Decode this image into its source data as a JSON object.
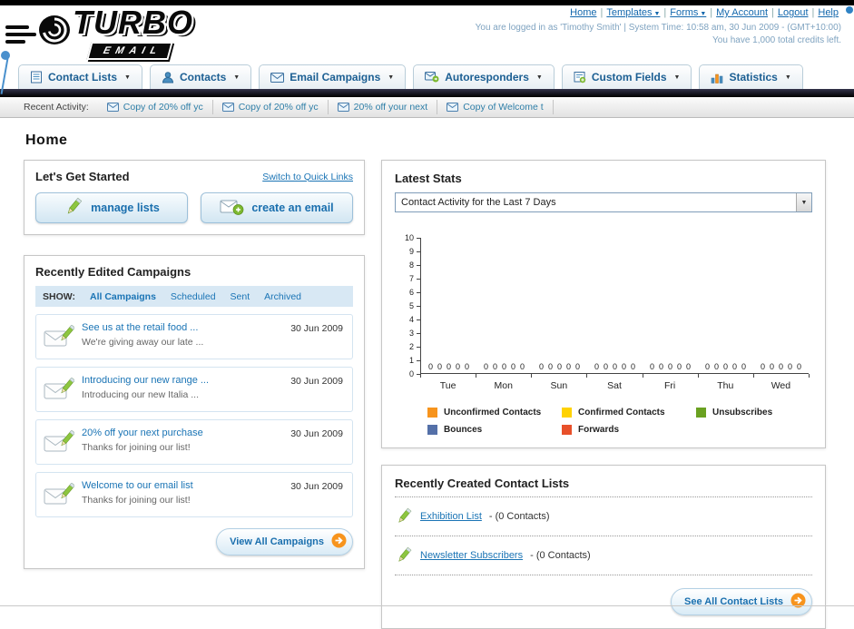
{
  "header": {
    "logo": {
      "title": "TURBO",
      "subtitle": "EMAIL"
    },
    "nav_links": [
      {
        "label": "Home"
      },
      {
        "label": "Templates",
        "dropdown": true
      },
      {
        "label": "Forms",
        "dropdown": true
      },
      {
        "label": "My Account"
      },
      {
        "label": "Logout"
      },
      {
        "label": "Help"
      }
    ],
    "login_info": "You are logged in as 'Timothy Smith' | System Time: 10:58 am, 30 Jun 2009 - (GMT+10:00)",
    "credits_info": "You have 1,000 total credits left."
  },
  "tabs": [
    {
      "label": "Contact Lists",
      "icon": "contact-lists-icon"
    },
    {
      "label": "Contacts",
      "icon": "contacts-icon"
    },
    {
      "label": "Email Campaigns",
      "icon": "email-campaigns-icon"
    },
    {
      "label": "Autoresponders",
      "icon": "autoresponders-icon"
    },
    {
      "label": "Custom Fields",
      "icon": "custom-fields-icon"
    },
    {
      "label": "Statistics",
      "icon": "statistics-icon"
    }
  ],
  "recent_activity": {
    "label": "Recent Activity:",
    "items": [
      {
        "label": "Copy of 20% off yc"
      },
      {
        "label": "Copy of 20% off yc"
      },
      {
        "label": "20% off your next"
      },
      {
        "label": "Copy of Welcome t"
      }
    ]
  },
  "page_title": "Home",
  "get_started": {
    "title": "Let's Get Started",
    "switch_link": "Switch to Quick Links",
    "buttons": [
      {
        "label": "manage lists",
        "icon": "pencil-icon"
      },
      {
        "label": "create an email",
        "icon": "envelope-plus-icon"
      }
    ]
  },
  "campaigns": {
    "title": "Recently Edited Campaigns",
    "show_label": "SHOW:",
    "filters": [
      "All Campaigns",
      "Scheduled",
      "Sent",
      "Archived"
    ],
    "active_filter": "All Campaigns",
    "items": [
      {
        "title": "See us at the retail food ...",
        "subtitle": "We're giving away our late ...",
        "date": "30 Jun 2009"
      },
      {
        "title": "Introducing our new range ...",
        "subtitle": "Introducing our new Italia ...",
        "date": "30 Jun 2009"
      },
      {
        "title": "20% off your next purchase",
        "subtitle": "Thanks for joining our list!",
        "date": "30 Jun 2009"
      },
      {
        "title": "Welcome to our email list",
        "subtitle": "Thanks for joining our list!",
        "date": "30 Jun 2009"
      }
    ],
    "view_all_label": "View All Campaigns"
  },
  "stats": {
    "title": "Latest Stats",
    "dropdown_value": "Contact Activity for the Last 7 Days",
    "chart_data": {
      "type": "bar",
      "title": "Contact Activity for the Last 7 Days",
      "categories": [
        "Tue",
        "Mon",
        "Sun",
        "Sat",
        "Fri",
        "Thu",
        "Wed"
      ],
      "series": [
        {
          "name": "Unconfirmed Contacts",
          "color": "#f7941d",
          "values": [
            0,
            0,
            0,
            0,
            0,
            0,
            0
          ]
        },
        {
          "name": "Confirmed Contacts",
          "color": "#ffd200",
          "values": [
            0,
            0,
            0,
            0,
            0,
            0,
            0
          ]
        },
        {
          "name": "Unsubscribes",
          "color": "#6aa121",
          "values": [
            0,
            0,
            0,
            0,
            0,
            0,
            0
          ]
        },
        {
          "name": "Bounces",
          "color": "#5470a8",
          "values": [
            0,
            0,
            0,
            0,
            0,
            0,
            0
          ]
        },
        {
          "name": "Forwards",
          "color": "#e8502a",
          "values": [
            0,
            0,
            0,
            0,
            0,
            0,
            0
          ]
        }
      ],
      "ylim": [
        0,
        10
      ],
      "yticks": [
        0,
        1,
        2,
        3,
        4,
        5,
        6,
        7,
        8,
        9,
        10
      ],
      "legend_position": "bottom",
      "grid": false
    },
    "legend": [
      {
        "label": "Unconfirmed Contacts",
        "color": "#f7941d"
      },
      {
        "label": "Confirmed Contacts",
        "color": "#ffd200"
      },
      {
        "label": "Unsubscribes",
        "color": "#6aa121"
      },
      {
        "label": "Bounces",
        "color": "#5470a8"
      },
      {
        "label": "Forwards",
        "color": "#e8502a"
      }
    ]
  },
  "contact_lists": {
    "title": "Recently Created Contact Lists",
    "items": [
      {
        "name": "Exhibition List",
        "detail": "- (0 Contacts)"
      },
      {
        "name": "Newsletter Subscribers",
        "detail": "- (0 Contacts)"
      }
    ],
    "see_all_label": "See All Contact Lists"
  }
}
